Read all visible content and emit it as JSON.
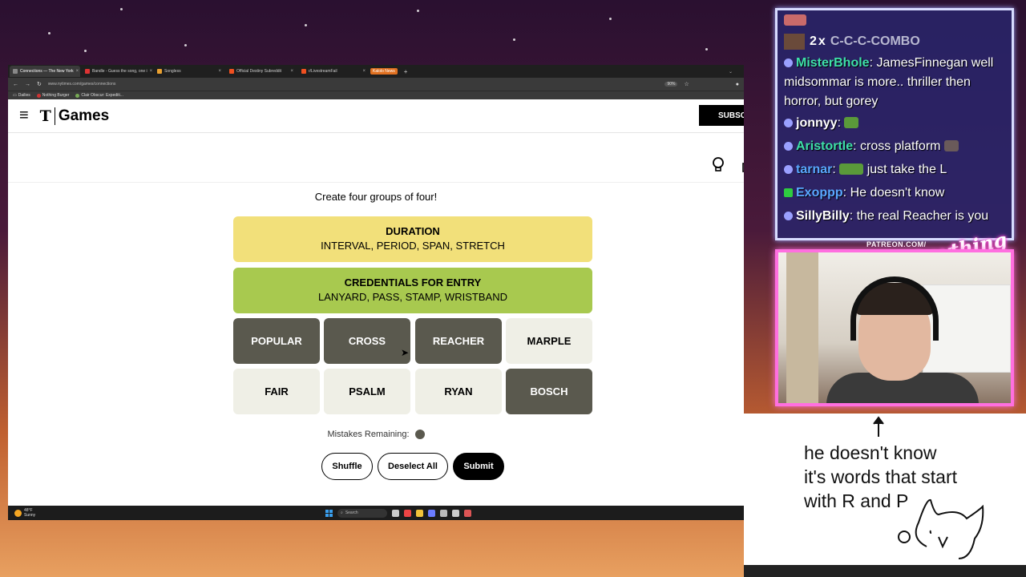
{
  "browser": {
    "tabs": [
      {
        "label": "Connections — The New York",
        "active": true
      },
      {
        "label": "Bandle - Guess the song, one i",
        "active": false
      },
      {
        "label": "Songless",
        "active": false
      },
      {
        "label": "Official Destiny Subreddit",
        "active": false
      },
      {
        "label": "r/LivestreamFail",
        "active": false
      }
    ],
    "news_chip": "Kalolo News",
    "url": "www.nytimes.com/games/connections",
    "zoom": "90%",
    "bookmarks": [
      "Dailies",
      "Nothing Burger",
      "Clair Obscur: Expediti..."
    ]
  },
  "nyt": {
    "logo": "T",
    "games": "Games",
    "subscribe": "SUBSCRIBE"
  },
  "game": {
    "instructions": "Create four groups of four!",
    "solved": [
      {
        "title": "DURATION",
        "words": "INTERVAL, PERIOD, SPAN, STRETCH",
        "color": "#f2e07a"
      },
      {
        "title": "CREDENTIALS FOR ENTRY",
        "words": "LANYARD, PASS, STAMP, WRISTBAND",
        "color": "#a8c94f"
      }
    ],
    "tiles": [
      {
        "word": "POPULAR",
        "selected": true
      },
      {
        "word": "CROSS",
        "selected": true
      },
      {
        "word": "REACHER",
        "selected": true
      },
      {
        "word": "MARPLE",
        "selected": false
      },
      {
        "word": "FAIR",
        "selected": false
      },
      {
        "word": "PSALM",
        "selected": false
      },
      {
        "word": "RYAN",
        "selected": false
      },
      {
        "word": "BOSCH",
        "selected": true
      }
    ],
    "mistakes_label": "Mistakes Remaining:",
    "mistakes_remaining": 1,
    "buttons": {
      "shuffle": "Shuffle",
      "deselect": "Deselect All",
      "submit": "Submit"
    }
  },
  "taskbar": {
    "temp": "48°F",
    "weather": "Sunny",
    "search": "Search"
  },
  "chat": {
    "combo_count": "2",
    "combo_x": "x",
    "combo_text": "C-C-C-COMBO",
    "messages": [
      {
        "user": "MisterBhole",
        "color": "#3ee0a8",
        "text": "JamesFinnegan well midsommar is more.. thriller then horror, but gorey"
      },
      {
        "user": "jonnyy",
        "color": "#ffffff",
        "text": ""
      },
      {
        "user": "Aristortle",
        "color": "#3ee0a8",
        "text": "cross platform"
      },
      {
        "user": "tarnar",
        "color": "#59a8ff",
        "text": "just take the L"
      },
      {
        "user": "Exoppp",
        "color": "#59a8ff",
        "text": "He doesn't know"
      },
      {
        "user": "SillyBilly",
        "color": "#ffffff",
        "text": "the real Reacher is you"
      }
    ],
    "patreon": "PATREON.COM/",
    "brand": "Anything Else"
  },
  "note": {
    "lines": [
      "he doesn't know",
      "it's words that start",
      "with R and P"
    ]
  }
}
